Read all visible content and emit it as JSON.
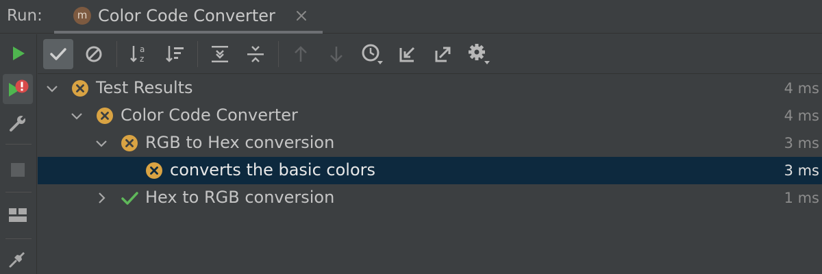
{
  "header": {
    "run_label": "Run:",
    "tab": {
      "icon_letter": "m",
      "title": "Color Code Converter",
      "close_icon": "close-icon"
    }
  },
  "sidebar": {
    "items": [
      {
        "name": "rerun",
        "icon": "play-icon"
      },
      {
        "name": "rerun-failed-tests",
        "icon": "rerun-failed-icon"
      },
      {
        "name": "settings",
        "icon": "wrench-icon"
      },
      {
        "name": "stop",
        "icon": "stop-icon"
      },
      {
        "name": "layout",
        "icon": "layout-icon"
      },
      {
        "name": "pin-tab",
        "icon": "pin-icon"
      }
    ]
  },
  "toolbar": {
    "buttons": [
      {
        "name": "show-passed",
        "icon": "checkmark-icon",
        "active": true
      },
      {
        "name": "show-ignored",
        "icon": "ignore-icon"
      },
      {
        "name": "sort-alphabetically",
        "icon": "sort-alpha-icon"
      },
      {
        "name": "sort-by-duration",
        "icon": "sort-duration-icon"
      },
      {
        "name": "expand-all",
        "icon": "expand-all-icon"
      },
      {
        "name": "collapse-all",
        "icon": "collapse-all-icon"
      },
      {
        "name": "previous-failed-test",
        "icon": "arrow-up-icon",
        "disabled": true
      },
      {
        "name": "next-failed-test",
        "icon": "arrow-down-icon",
        "disabled": true
      },
      {
        "name": "test-history",
        "icon": "history-icon"
      },
      {
        "name": "import-tests",
        "icon": "import-icon"
      },
      {
        "name": "export-tests",
        "icon": "export-icon"
      },
      {
        "name": "settings",
        "icon": "gear-icon"
      }
    ]
  },
  "tree": {
    "rows": [
      {
        "label": "Test Results",
        "time": "4 ms",
        "status": "failed",
        "expanded": true
      },
      {
        "label": "Color Code Converter",
        "time": "4 ms",
        "status": "failed",
        "expanded": true
      },
      {
        "label": "RGB to Hex conversion",
        "time": "3 ms",
        "status": "failed",
        "expanded": true
      },
      {
        "label": "converts the basic colors",
        "time": "3 ms",
        "status": "failed",
        "selected": true
      },
      {
        "label": "Hex to RGB conversion",
        "time": "1 ms",
        "status": "passed",
        "expanded": false
      }
    ]
  },
  "colors": {
    "failed": "#d9a343",
    "passed": "#5fb85a",
    "run_green": "#4fb64f",
    "error_red": "#d84a4a",
    "selection": "#0d293e"
  }
}
